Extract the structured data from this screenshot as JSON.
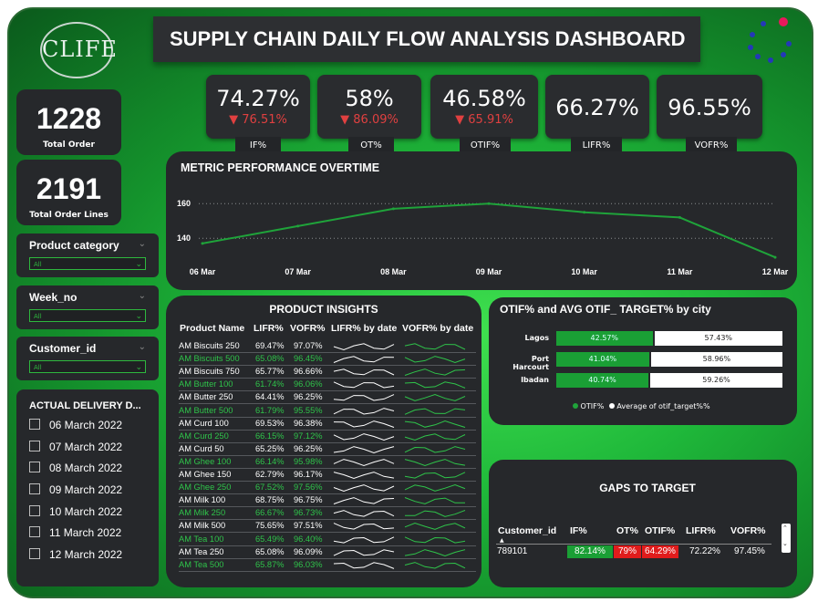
{
  "app": {
    "title": "SUPPLY CHAIN DAILY FLOW ANALYSIS DASHBOARD",
    "logo_text": "CLIFE"
  },
  "kpis": [
    {
      "value": "1228",
      "label": "Total Order"
    },
    {
      "value": "2191",
      "label": "Total Order Lines"
    }
  ],
  "metrics": [
    {
      "value": "74.27%",
      "sub": "▼ 76.51%",
      "tag": "IF%"
    },
    {
      "value": "58%",
      "sub": "▼ 86.09%",
      "tag": "OT%"
    },
    {
      "value": "46.58%",
      "sub": "▼ 65.91%",
      "tag": "OTIF%"
    },
    {
      "value": "66.27%",
      "sub": "",
      "tag": "LIFR%"
    },
    {
      "value": "96.55%",
      "sub": "",
      "tag": "VOFR%"
    }
  ],
  "slicers": [
    {
      "title": "Product category",
      "value": "All"
    },
    {
      "title": "Week_no",
      "value": "All"
    },
    {
      "title": "Customer_id",
      "value": "All"
    }
  ],
  "delivery": {
    "title": "ACTUAL DELIVERY D...",
    "dates": [
      "06 March 2022",
      "07 March 2022",
      "08 March 2022",
      "09 March 2022",
      "10 March 2022",
      "11 March 2022",
      "12 March 2022"
    ]
  },
  "colors": {
    "accent": "#1fa33a",
    "negative": "#e04040",
    "panel": "#26282b"
  },
  "chart_data": [
    {
      "type": "line",
      "title": "METRIC PERFORMANCE OVERTIME",
      "categories": [
        "06 Mar",
        "07 Mar",
        "08 Mar",
        "09 Mar",
        "10 Mar",
        "11 Mar",
        "12 Mar"
      ],
      "series": [
        {
          "values": [
            137,
            147,
            157,
            160,
            155,
            152,
            129
          ]
        }
      ],
      "y_ticks": [
        "160",
        "140"
      ],
      "ylim": [
        128,
        168
      ],
      "grid": true
    },
    {
      "type": "bar",
      "title": "OTIF% and AVG OTIF_ TARGET% by city",
      "categories": [
        "Lagos",
        "Port Harcourt",
        "Ibadan"
      ],
      "series": [
        {
          "name": "OTIF%",
          "values": [
            42.57,
            41.04,
            40.74
          ],
          "labels": [
            "42.57%",
            "41.04%",
            "40.74%"
          ]
        },
        {
          "name": "Average of otif_target%%",
          "values": [
            57.43,
            58.96,
            59.26
          ],
          "labels": [
            "57.43%",
            "58.96%",
            "59.26%"
          ]
        }
      ],
      "stacked": true,
      "legend": "bottom"
    }
  ],
  "product_insights": {
    "title": "PRODUCT INSIGHTS",
    "headers": [
      "Product Name",
      "LIFR%",
      "VOFR%",
      "LIFR% by date",
      "VOFR% by date"
    ],
    "rows": [
      {
        "name": "AM Biscuits 250",
        "lifr": "69.47%",
        "vofr": "97.07%",
        "green": false
      },
      {
        "name": "AM Biscuits 500",
        "lifr": "65.08%",
        "vofr": "96.45%",
        "green": true
      },
      {
        "name": "AM Biscuits 750",
        "lifr": "65.77%",
        "vofr": "96.66%",
        "green": false
      },
      {
        "name": "AM Butter 100",
        "lifr": "61.74%",
        "vofr": "96.06%",
        "green": true
      },
      {
        "name": "AM Butter 250",
        "lifr": "64.41%",
        "vofr": "96.25%",
        "green": false
      },
      {
        "name": "AM Butter 500",
        "lifr": "61.79%",
        "vofr": "95.55%",
        "green": true
      },
      {
        "name": "AM Curd 100",
        "lifr": "69.53%",
        "vofr": "96.38%",
        "green": false
      },
      {
        "name": "AM Curd 250",
        "lifr": "66.15%",
        "vofr": "97.12%",
        "green": true
      },
      {
        "name": "AM Curd 50",
        "lifr": "65.25%",
        "vofr": "96.25%",
        "green": false
      },
      {
        "name": "AM Ghee 100",
        "lifr": "66.14%",
        "vofr": "95.98%",
        "green": true
      },
      {
        "name": "AM Ghee 150",
        "lifr": "62.79%",
        "vofr": "96.17%",
        "green": false
      },
      {
        "name": "AM Ghee 250",
        "lifr": "67.52%",
        "vofr": "97.56%",
        "green": true
      },
      {
        "name": "AM Milk 100",
        "lifr": "68.75%",
        "vofr": "96.75%",
        "green": false
      },
      {
        "name": "AM Milk 250",
        "lifr": "66.67%",
        "vofr": "96.73%",
        "green": true
      },
      {
        "name": "AM Milk 500",
        "lifr": "75.65%",
        "vofr": "97.51%",
        "green": false
      },
      {
        "name": "AM Tea 100",
        "lifr": "65.49%",
        "vofr": "96.40%",
        "green": true
      },
      {
        "name": "AM Tea 250",
        "lifr": "65.08%",
        "vofr": "96.09%",
        "green": false
      },
      {
        "name": "AM Tea 500",
        "lifr": "65.87%",
        "vofr": "96.03%",
        "green": true
      }
    ]
  },
  "gaps": {
    "title": "GAPS TO TARGET",
    "headers": [
      "Customer_id",
      "IF%",
      "OT%",
      "OTIF%",
      "LIFR%",
      "VOFR%"
    ],
    "row": [
      "789101",
      "82.14%",
      "79%",
      "64.29%",
      "72.22%",
      "97.45%"
    ]
  }
}
